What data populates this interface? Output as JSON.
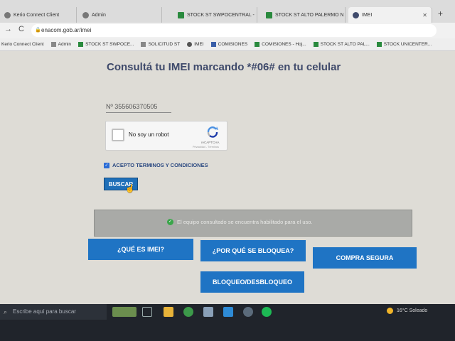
{
  "browser": {
    "tabs": [
      {
        "title": "Kerio Connect Client"
      },
      {
        "title": "Admin"
      },
      {
        "title": "STOCK ST SWPOCENTRAL - "
      },
      {
        "title": "STOCK ST ALTO PALERMO N"
      },
      {
        "title": "IMEI"
      }
    ],
    "url": "enacom.gob.ar/imei",
    "bookmarks": [
      "Kerio Connect Client",
      "Admin",
      "STOCK ST SWPOCE...",
      "SOLICITUD ST",
      "IMEI",
      "COMISIONES",
      "COMISIONES - Hoj...",
      "STOCK ST ALTO PAL...",
      "STOCK UNICENTER..."
    ]
  },
  "page": {
    "title": "Consultá tu IMEI marcando *#06# en tu celular",
    "imei_input": {
      "value": "Nº 355606370505"
    },
    "recaptcha": {
      "label": "No soy un robot",
      "brand": "reCAPTCHA",
      "terms": "Privacidad - Términos"
    },
    "terms": {
      "label": "ACEPTO TERMINOS Y CONDICIONES",
      "checked": true
    },
    "search_button": "BUSCAR",
    "status_message": "El equipo consultado se encuentra habilitado para el uso.",
    "buttons": {
      "que_es_imei": "¿QUÉ ES IMEI?",
      "por_que_se_bloquea": "¿POR QUÉ SE BLOQUEA?",
      "compra_segura": "COMPRA SEGURA",
      "bloqueo": "BLOQUEO/DESBLOQUEO"
    }
  },
  "taskbar": {
    "search_placeholder": "Escribe aquí para buscar",
    "weather": "16°C  Soleado"
  },
  "colors": {
    "accent": "#1f74c4",
    "title": "#3f4a6b",
    "status_bg": "#a9aaa7",
    "success": "#3aa64a"
  }
}
